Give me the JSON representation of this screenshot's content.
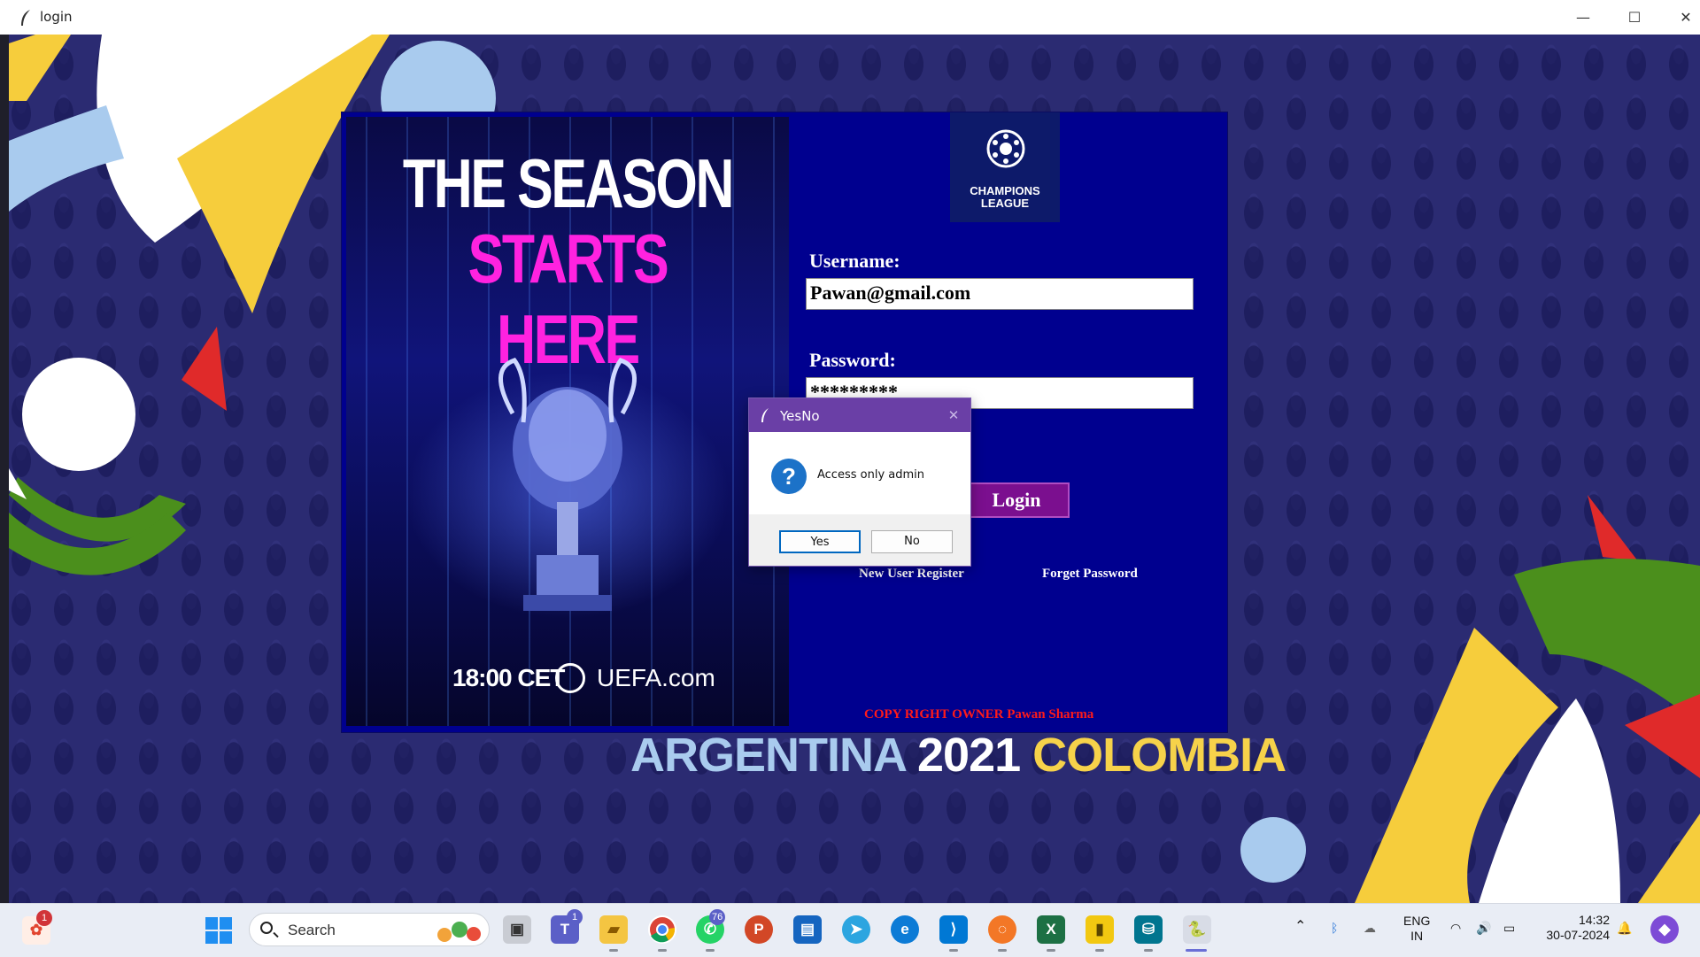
{
  "window": {
    "title": "login"
  },
  "poster": {
    "line1": "THE SEASON",
    "line2": "STARTS HERE",
    "time": "18:00 CET",
    "site": "UEFA.com"
  },
  "logo": {
    "text": "CHAMPIONS\nLEAGUE"
  },
  "form": {
    "username_label": "Username:",
    "username_value": "Pawan@gmail.com",
    "password_label": "Password:",
    "password_value": "*********",
    "login_label": "Login",
    "register_link": "New User Register",
    "forgot_link": "Forget Password",
    "copyright": "COPY RIGHT OWNER Pawan Sharma"
  },
  "banner": {
    "left": "ARGENTINA",
    "year": "2021",
    "right": "COLOMBIA"
  },
  "dialog": {
    "title": "YesNo",
    "message": "Access only admin",
    "yes_label": "Yes",
    "no_label": "No"
  },
  "taskbar": {
    "search_label": "Search",
    "notif_count": "1",
    "teams_badge": "1",
    "whatsapp_badge": "76",
    "lang_top": "ENG",
    "lang_bottom": "IN",
    "time": "14:32",
    "date": "30-07-2024"
  },
  "colors": {
    "panel": "#00008f",
    "login_button": "#7b0f8f",
    "dialog_title": "#6a3fa6",
    "copyright": "#ff1a1a"
  }
}
